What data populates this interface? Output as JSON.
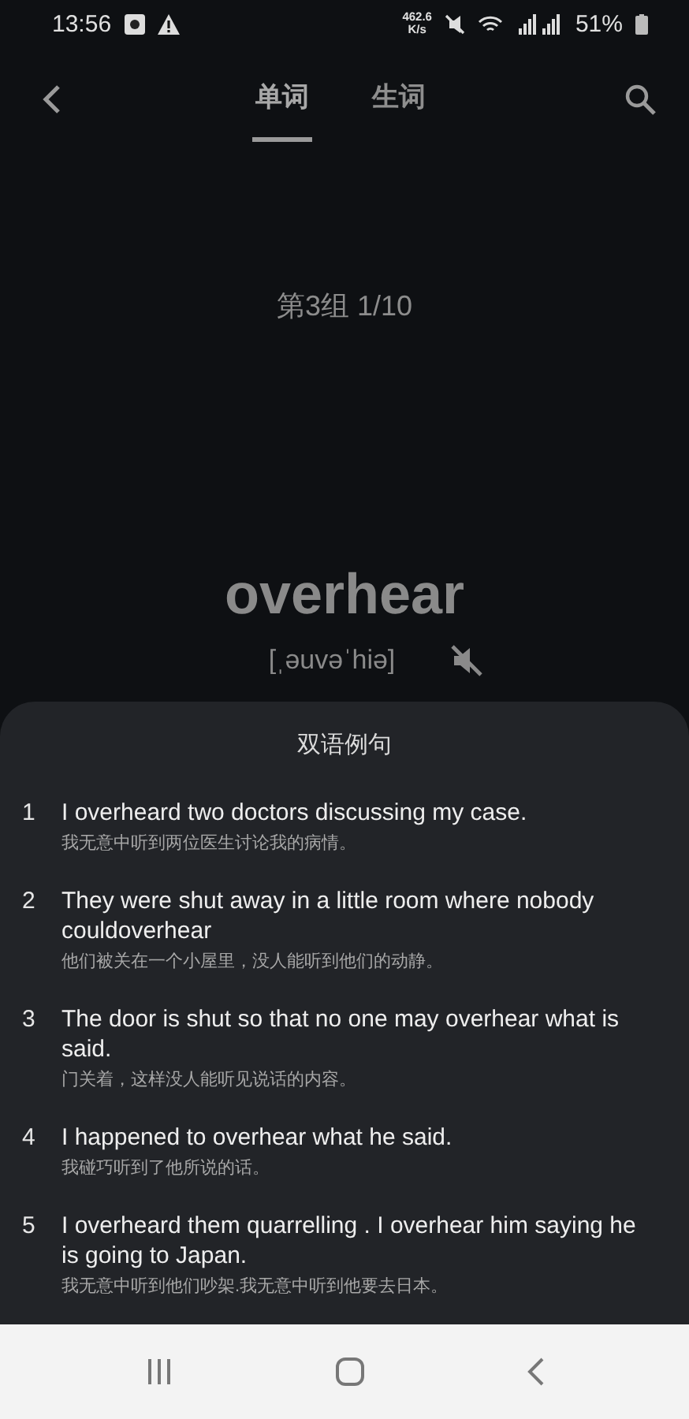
{
  "status_bar": {
    "time": "13:56",
    "speed_value": "462.6",
    "speed_unit": "K/s",
    "battery": "51%"
  },
  "tabs": [
    {
      "label": "单词",
      "selected": true
    },
    {
      "label": "生词",
      "selected": false
    }
  ],
  "group_progress": "第3组 1/10",
  "word": "overhear",
  "phonetic": "[ˌəuvəˈhiə]",
  "sheet": {
    "title": "双语例句",
    "examples": [
      {
        "number": "1",
        "sentence": "I overheard two doctors discussing my case.",
        "translation": "我无意中听到两位医生讨论我的病情。"
      },
      {
        "number": "2",
        "sentence": "They were shut away in a little room where nobody couldoverhear",
        "translation": "他们被关在一个小屋里，没人能听到他们的动静。"
      },
      {
        "number": "3",
        "sentence": "The door is shut so that no one may overhear what is said.",
        "translation": "门关着，这样没人能听见说话的内容。"
      },
      {
        "number": "4",
        "sentence": "I happened to overhear what he said.",
        "translation": "我碰巧听到了他所说的话。"
      },
      {
        "number": "5",
        "sentence": "I overheard them quarrelling . I overhear him saying he is going to Japan.",
        "translation": "我无意中听到他们吵架.我无意中听到他要去日本。"
      }
    ]
  }
}
